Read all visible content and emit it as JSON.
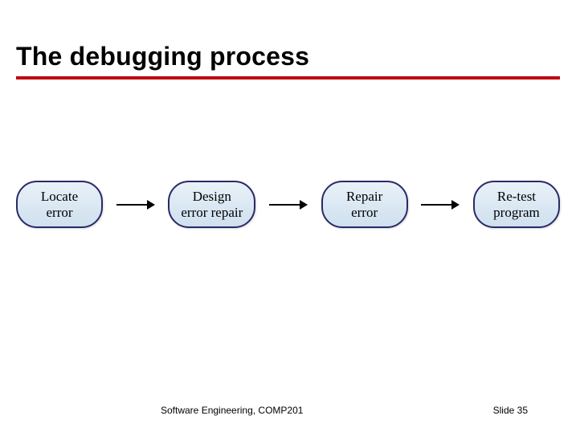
{
  "title": "The debugging process",
  "nodes": {
    "n1": {
      "line1": "Locate",
      "line2": "error"
    },
    "n2": {
      "line1": "Design",
      "line2": "error repair"
    },
    "n3": {
      "line1": "Repair",
      "line2": "error"
    },
    "n4": {
      "line1": "Re-test",
      "line2": "program"
    }
  },
  "footer": {
    "left": "Software Engineering, COMP201",
    "right_label": "Slide",
    "right_num": "35"
  }
}
